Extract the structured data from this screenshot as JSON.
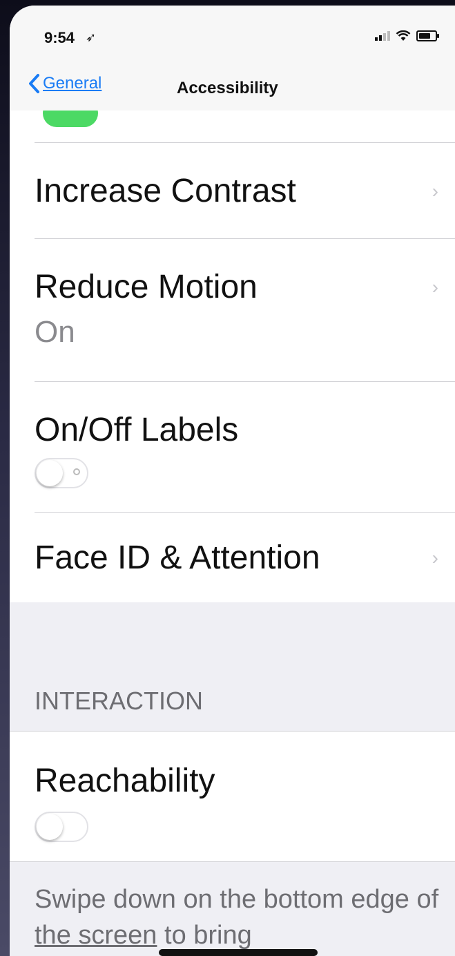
{
  "status_bar": {
    "time": "9:54"
  },
  "nav": {
    "back_label": "General",
    "title": "Accessibility"
  },
  "rows": [
    {
      "title": "Increase Contrast"
    },
    {
      "title": "Reduce Motion",
      "subtitle": "On"
    },
    {
      "title": "On/Off Labels",
      "toggle": "off"
    },
    {
      "title": "Face ID & Attention"
    }
  ],
  "interaction": {
    "section_header": "INTERACTION",
    "row_title": "Reachability",
    "toggle": "off",
    "footer_part1": "Swipe down on the bottom edge of ",
    "footer_underlined": "the screen",
    "footer_part2": " to bring"
  },
  "colors": {
    "accent": "#1a7cf5",
    "toggle_on": "#4cd964"
  }
}
